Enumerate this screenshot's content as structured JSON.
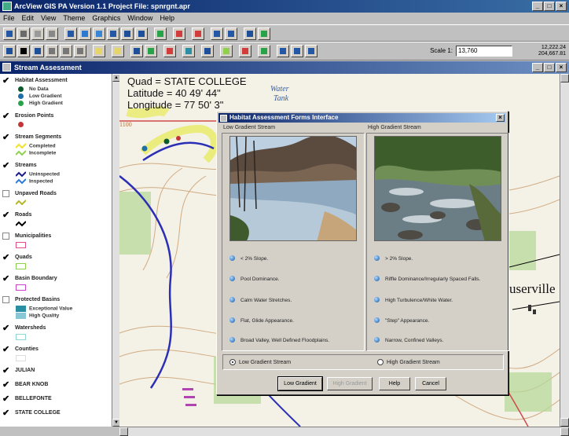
{
  "window": {
    "title": "ArcView GIS  PA Version 1.1   Project File: spnrgnt.apr"
  },
  "menu": [
    "File",
    "Edit",
    "View",
    "Theme",
    "Graphics",
    "Window",
    "Help"
  ],
  "toolbar": {
    "scale_label": "Scale 1:",
    "scale_value": "13,760",
    "coord_x": "12,222.24",
    "coord_y": "204,667.81"
  },
  "view": {
    "title": "Stream Assessment"
  },
  "toc": {
    "layers": [
      {
        "name": "Habitat Assessment",
        "checked": true,
        "legend": [
          {
            "label": "No Data",
            "symbol": "dot",
            "color": "#0a5a2a"
          },
          {
            "label": "Low Gradient",
            "symbol": "dot",
            "color": "#1d6fa8"
          },
          {
            "label": "High Gradient",
            "symbol": "dot",
            "color": "#27a34a"
          }
        ]
      },
      {
        "name": "Erosion Points",
        "checked": true,
        "legend": [
          {
            "label": "",
            "symbol": "dot",
            "color": "#c23636"
          }
        ]
      },
      {
        "name": "Stream Segments",
        "checked": true,
        "legend": [
          {
            "label": "Completed",
            "symbol": "line",
            "color": "#f1e22a"
          },
          {
            "label": "Incomplete",
            "symbol": "line",
            "color": "#8fd14f"
          }
        ]
      },
      {
        "name": "Streams",
        "checked": true,
        "legend": [
          {
            "label": "Uninspected",
            "symbol": "line",
            "color": "#1a1a8e"
          },
          {
            "label": "Inspected",
            "symbol": "line",
            "color": "#2f7ad9"
          }
        ]
      },
      {
        "name": "Unpaved Roads",
        "checked": false,
        "legend": [
          {
            "label": "",
            "symbol": "line",
            "color": "#b5b52a"
          }
        ]
      },
      {
        "name": "Roads",
        "checked": true,
        "legend": [
          {
            "label": "",
            "symbol": "line",
            "color": "#000000"
          }
        ]
      },
      {
        "name": "Municipalities",
        "checked": false,
        "legend": [
          {
            "label": "",
            "symbol": "box",
            "color": "#e34d8a"
          }
        ]
      },
      {
        "name": "Quads",
        "checked": true,
        "legend": [
          {
            "label": "",
            "symbol": "box",
            "color": "#8fd14f"
          }
        ]
      },
      {
        "name": "Basin Boundary",
        "checked": true,
        "legend": [
          {
            "label": "",
            "symbol": "box",
            "color": "#cc44cc"
          }
        ]
      },
      {
        "name": "Protected Basins",
        "checked": false,
        "legend": [
          {
            "label": "Exceptional Value",
            "symbol": "fill",
            "color": "#2a8fa3"
          },
          {
            "label": "High Quality",
            "symbol": "fill",
            "color": "#89c7d6"
          }
        ]
      },
      {
        "name": "Watersheds",
        "checked": true,
        "legend": [
          {
            "label": "",
            "symbol": "box",
            "color": "#8fd6d6"
          }
        ]
      },
      {
        "name": "Counties",
        "checked": true,
        "legend": [
          {
            "label": "",
            "symbol": "box",
            "color": "#dddddd"
          }
        ]
      },
      {
        "name": "JULIAN",
        "checked": true,
        "legend": []
      },
      {
        "name": "BEAR KNOB",
        "checked": true,
        "legend": []
      },
      {
        "name": "BELLEFONTE",
        "checked": true,
        "legend": []
      },
      {
        "name": "STATE COLLEGE",
        "checked": true,
        "legend": []
      }
    ]
  },
  "map": {
    "quad_line": "Quad = STATE COLLEGE",
    "latitude_line": "Latitude = 40 49' 44\"",
    "longitude_line": "Longitude = 77 50' 3\"",
    "label_water": "Water",
    "label_tank": "Tank",
    "label_contour": "1100",
    "label_town": "userville"
  },
  "dialog": {
    "title": "Habitat Assessment Forms Interface",
    "low": {
      "heading": "Low Gradient Stream",
      "bullets": [
        "< 2% Slope.",
        "Pool Dominance.",
        "Calm Water Stretches.",
        "Flat, Glide Appearance.",
        "Broad Valley, Well Defined Floodplains."
      ]
    },
    "high": {
      "heading": "High Gradient Stream",
      "bullets": [
        "> 2% Slope.",
        "Riffle Dominance/Irregularly Spaced Falls.",
        "High Turbulence/White Water.",
        "\"Step\" Appearance.",
        "Narrow, Confined Valleys."
      ]
    },
    "radio_low": "Low Gradient Stream",
    "radio_high": "High Gradient Stream",
    "buttons": {
      "low": "Low Gradient",
      "high": "High Gradient",
      "help": "Help",
      "cancel": "Cancel"
    }
  }
}
